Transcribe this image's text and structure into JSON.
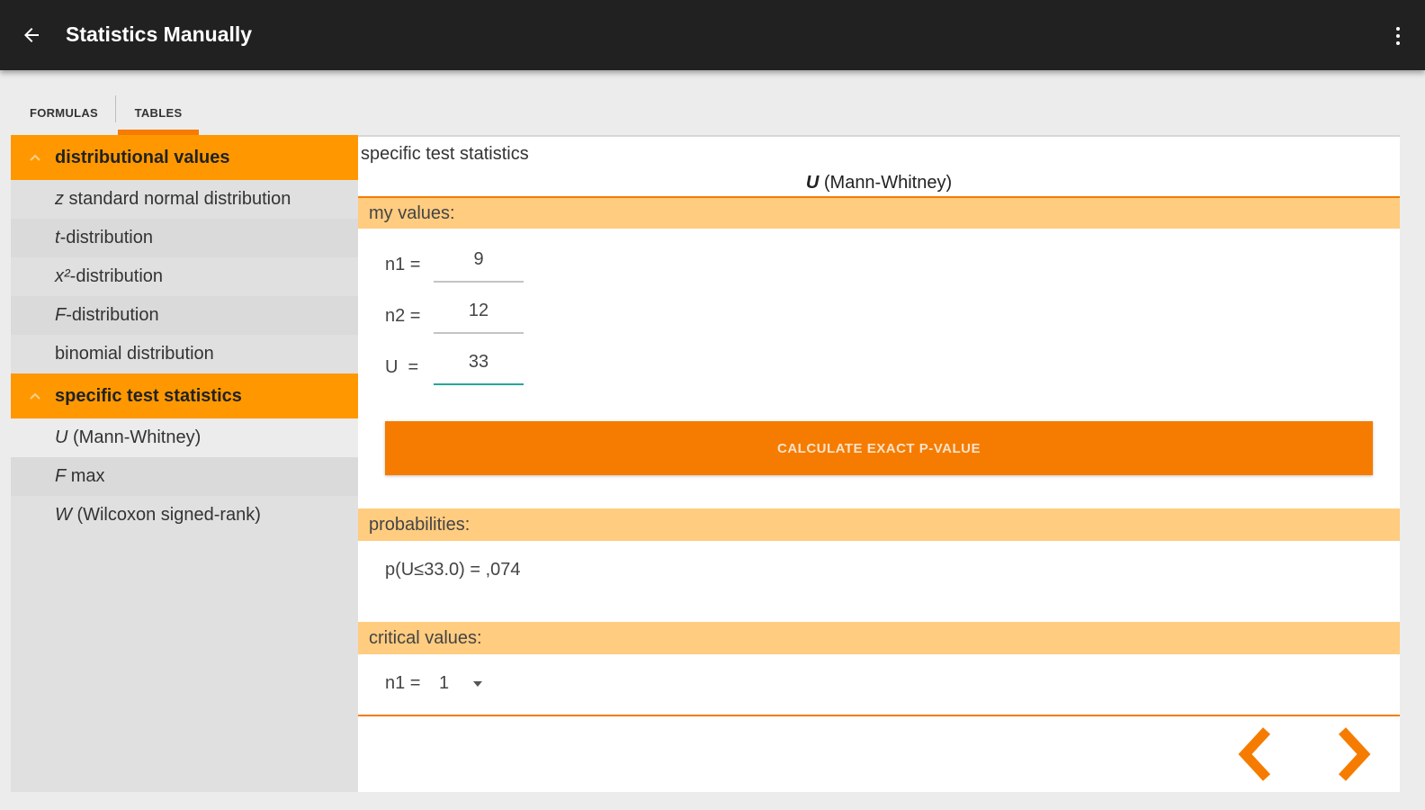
{
  "appbar": {
    "title": "Statistics Manually",
    "back_icon": "arrow-left-icon",
    "overflow_icon": "more-vertical-icon"
  },
  "tabs": [
    {
      "label": "FORMULAS",
      "selected": false
    },
    {
      "label": "TABLES",
      "selected": true
    }
  ],
  "sidebar": {
    "groups": [
      {
        "label": "distributional values",
        "items": [
          {
            "prefix": "z",
            "label": " standard normal distribution"
          },
          {
            "prefix": "t",
            "label": "-distribution"
          },
          {
            "prefix": "x²",
            "label": "-distribution"
          },
          {
            "prefix": "F",
            "label": "-distribution"
          },
          {
            "prefix": "",
            "label": "binomial distribution"
          }
        ]
      },
      {
        "label": "specific test statistics",
        "items": [
          {
            "prefix": "U",
            "label": " (Mann-Whitney)"
          },
          {
            "prefix": "F",
            "label": " max"
          },
          {
            "prefix": "W",
            "label": " (Wilcoxon signed-rank)"
          }
        ]
      }
    ]
  },
  "content": {
    "breadcrumb": "specific test statistics",
    "title_symbol": "U",
    "title_rest": " (Mann-Whitney)",
    "my_values_header": "my values:",
    "fields": {
      "n1": {
        "label": "n1 =",
        "value": "9"
      },
      "n2": {
        "label": "n2 =",
        "value": "12"
      },
      "u": {
        "label": "U  =",
        "value": "33"
      }
    },
    "calculate_button": "CALCULATE EXACT P-VALUE",
    "probabilities_header": "probabilities:",
    "probability_result": "p(U≤33.0) = ,074",
    "critical_header": "critical values:",
    "critical_select": {
      "label": "n1 =",
      "value": "1"
    }
  },
  "colors": {
    "appbar": "#212121",
    "accent": "#f57c00",
    "group_header": "#ff9800",
    "section_bar": "#ffcc80",
    "focus_underline": "#26a69a"
  }
}
